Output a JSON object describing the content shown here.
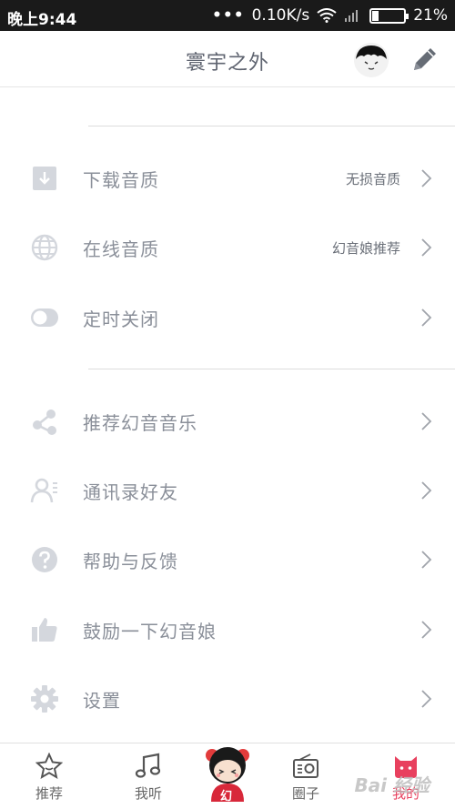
{
  "status_bar": {
    "time": "晚上9:44",
    "dots": "•••",
    "network_speed": "0.10K/s",
    "battery_percent_text": "21%",
    "battery_level": 0.21
  },
  "header": {
    "title": "寰宇之外",
    "avatar_icon": "cartoon-face-avatar",
    "edit_icon": "pencil-icon"
  },
  "menu": {
    "group1": [
      {
        "label": "下载音质",
        "value": "无损音质",
        "icon": "download-icon"
      },
      {
        "label": "在线音质",
        "value": "幻音娘推荐",
        "icon": "globe-icon"
      },
      {
        "label": "定时关闭",
        "value": "",
        "icon": "toggle-icon"
      }
    ],
    "group2": [
      {
        "label": "推荐幻音音乐",
        "icon": "share-icon"
      },
      {
        "label": "通讯录好友",
        "icon": "contacts-icon"
      },
      {
        "label": "帮助与反馈",
        "icon": "help-icon"
      },
      {
        "label": "鼓励一下幻音娘",
        "icon": "thumbs-up-icon"
      },
      {
        "label": "设置",
        "icon": "gear-icon"
      }
    ]
  },
  "tabbar": {
    "tabs": [
      {
        "label": "推荐",
        "icon": "star-icon"
      },
      {
        "label": "我听",
        "icon": "music-note-icon"
      },
      {
        "label": "",
        "icon": "mascot-avatar"
      },
      {
        "label": "圈子",
        "icon": "radio-icon"
      },
      {
        "label": "我的",
        "icon": "cat-face-icon"
      }
    ],
    "active_tab": "我的",
    "center_badge_text": "幻",
    "watermark": "Bai 经验"
  },
  "colors": {
    "accent": "#e8405e",
    "icon_gray": "#d4d7dd",
    "label_gray": "#8a8f99"
  }
}
